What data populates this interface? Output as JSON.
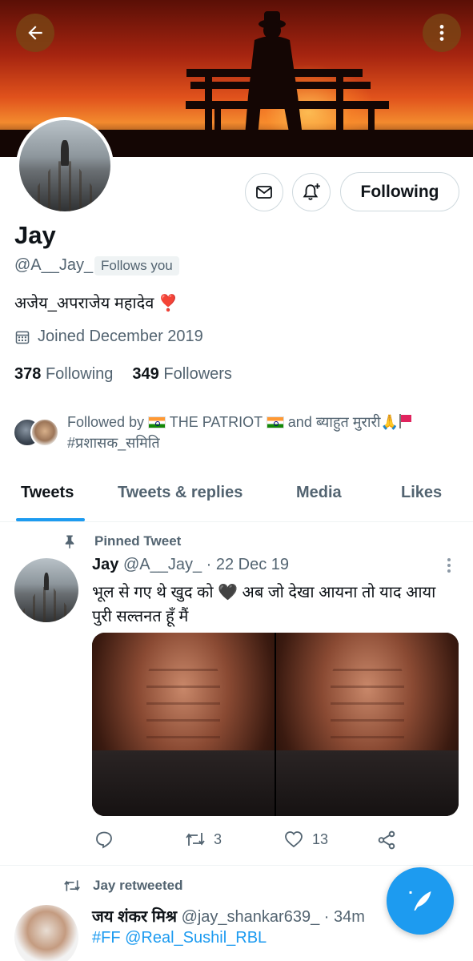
{
  "header": {
    "back_icon": "arrow-left-icon",
    "more_icon": "vertical-dots-icon"
  },
  "profile": {
    "name": "Jay",
    "handle": "@A__Jay_",
    "follows_you": "Follows you",
    "bio": "अजेय_अपराजेय महादेव ❣️",
    "joined": "Joined December 2019",
    "following_count": "378",
    "following_label": "Following",
    "followers_count": "349",
    "followers_label": "Followers",
    "follow_button": "Following",
    "followed_by_prefix": "Followed by",
    "followed_by_name1": "THE PATRIOT",
    "followed_by_and": "and ब्याहुत मुरारी🙏",
    "followed_by_line2": "#प्रशासक_समिति"
  },
  "tabs": [
    {
      "label": "Tweets",
      "active": true
    },
    {
      "label": "Tweets & replies",
      "active": false
    },
    {
      "label": "Media",
      "active": false
    },
    {
      "label": "Likes",
      "active": false
    }
  ],
  "pinned_tweet": {
    "pinned_label": "Pinned Tweet",
    "author": "Jay",
    "handle_date": "@A__Jay_ · 22 Dec 19",
    "text": "भूल से गए थे खुद को 🖤 अब जो देखा आयना तो याद आया पुरी सल्तनत हूँ मैं",
    "retweets": "3",
    "likes": "13"
  },
  "retweeted_tweet": {
    "retweet_label": "Jay retweeted",
    "author": "जय शंकर मिश्र",
    "handle_time": "@jay_shankar639_ · 34m",
    "text": "#FF @Real_Sushil_RBL"
  },
  "colors": {
    "accent": "#1d9bf0",
    "text_primary": "#0f1419",
    "text_secondary": "#536471",
    "border": "#cfd9de"
  }
}
